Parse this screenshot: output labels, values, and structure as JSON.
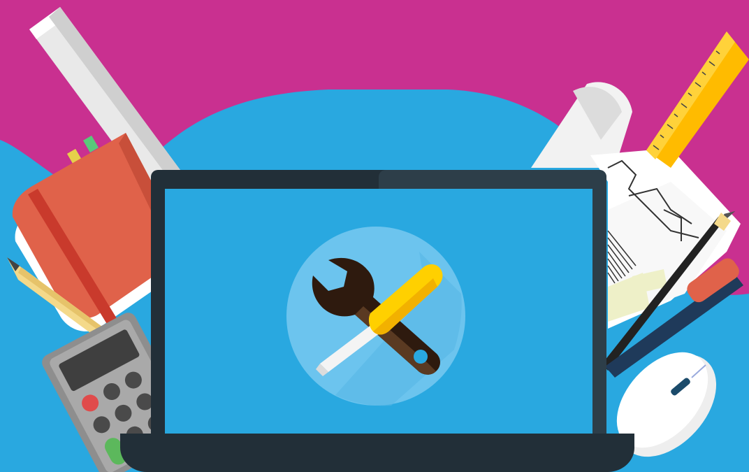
{
  "scene": {
    "subject": "maintenance-illustration",
    "icon": "wrench-and-screwdriver-icon",
    "colors": {
      "background_magenta": "#c93090",
      "background_blue": "#29a8e0",
      "laptop_frame": "#222f38",
      "screen": "#29a8e0",
      "icon_circle": "#6cc4ee",
      "wrench": "#2e1a0e",
      "screwdriver_handle": "#ffd000",
      "notebook": "#e0624a",
      "ruler": "#ffbb00"
    }
  }
}
